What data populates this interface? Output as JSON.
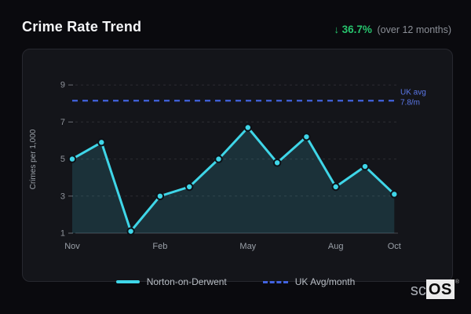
{
  "header": {
    "title": "Crime Rate Trend",
    "change_arrow": "↓",
    "change_percent": "36.7%",
    "change_period": "(over 12 months)"
  },
  "chart_data": {
    "type": "line",
    "title": "Crime Rate Trend",
    "ylabel": "Crimes per 1,000",
    "xlabel": "",
    "x_tick_labels": [
      "Nov",
      "Feb",
      "May",
      "Aug",
      "Oct"
    ],
    "x_tick_indices": [
      0,
      3,
      6,
      9,
      11
    ],
    "y_ticks": [
      1,
      3,
      5,
      7,
      9
    ],
    "ylim": [
      1,
      9.5
    ],
    "grid": true,
    "legend_position": "bottom",
    "series": [
      {
        "name": "Norton-on-Derwent",
        "type": "line",
        "area": true,
        "color": "#3fd6e8",
        "point_count": 12,
        "values": [
          5.0,
          5.9,
          1.1,
          3.0,
          3.5,
          5.0,
          6.7,
          4.8,
          6.2,
          3.5,
          4.6,
          3.1
        ]
      },
      {
        "name": "UK Avg/month",
        "type": "hline",
        "style": "dashed",
        "color": "#4263e0",
        "value": 8.15,
        "label_lines": [
          "UK avg",
          "7.8/m"
        ]
      }
    ]
  },
  "legend": {
    "items": [
      {
        "label": "Norton-on-Derwent",
        "swatch": "solid-line",
        "color": "#3fd6e8"
      },
      {
        "label": "UK Avg/month",
        "swatch": "dashed-line",
        "color": "#4263e0"
      }
    ]
  },
  "logo": {
    "prefix": "sc",
    "box": "OS",
    "reg": "®"
  },
  "colors": {
    "page_bg": "#0a0a0e",
    "card_bg": "#14151a",
    "card_border": "#27282f",
    "accent_cyan": "#3fd6e8",
    "uk_avg_blue": "#4263e0",
    "annotation_blue": "#5b77e8",
    "positive_green": "#27c46d",
    "axis_text": "#8f939b",
    "grid_line": "#2c2d33",
    "baseline": "#46484f"
  }
}
